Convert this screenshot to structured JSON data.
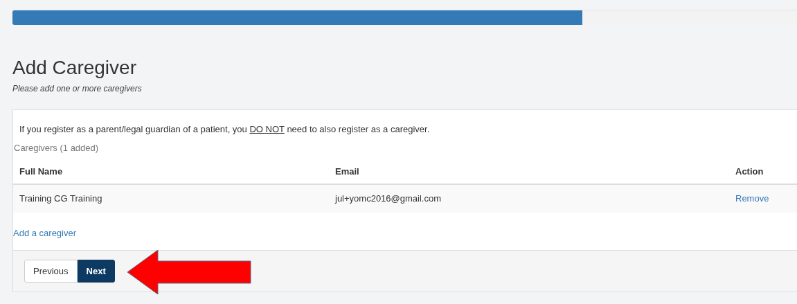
{
  "progress": {
    "level": 0.72
  },
  "heading": {
    "title": "Add Caregiver",
    "subtitle": "Please add one or more caregivers"
  },
  "notice": {
    "before": "If you register as a parent/legal guardian of a patient, you ",
    "underlined": "DO NOT",
    "after": " need to also register as a caregiver."
  },
  "caregivers_caption": "Caregivers (1 added)",
  "table": {
    "columns": [
      "Full Name",
      "Email",
      "Action"
    ],
    "rows": [
      {
        "full_name": "Training CG Training",
        "email": "jul+yomc2016@gmail.com",
        "action": "Remove"
      }
    ]
  },
  "add_link": "Add a caregiver",
  "buttons": [
    {
      "label": "Previous",
      "kind": "secondary"
    },
    {
      "label": "Next",
      "kind": "primary"
    }
  ]
}
